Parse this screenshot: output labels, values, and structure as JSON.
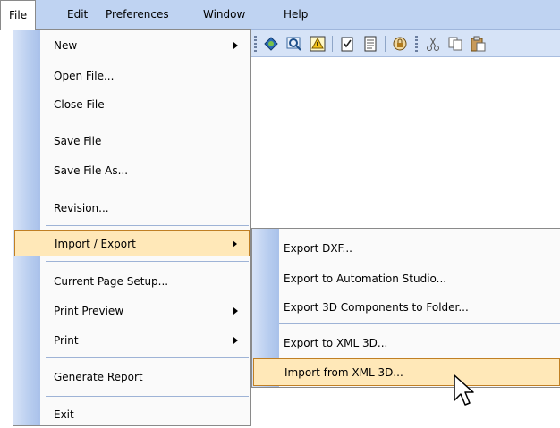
{
  "menubar": {
    "items": [
      {
        "label": "File"
      },
      {
        "label": "Edit"
      },
      {
        "label": "Preferences"
      },
      {
        "label": "Window"
      },
      {
        "label": "Help"
      }
    ]
  },
  "toolbar": {
    "icons": [
      "shape-tool-icon",
      "zoom-icon",
      "warning-icon",
      "checklist-icon",
      "document-icon",
      "lock-icon",
      "cut-icon",
      "copy-icon",
      "paste-icon"
    ]
  },
  "file_menu": {
    "items": [
      {
        "label": "New",
        "submenu": true
      },
      {
        "label": "Open File..."
      },
      {
        "label": "Close File"
      },
      {
        "label": "Save File"
      },
      {
        "label": "Save File As..."
      },
      {
        "label": "Revision..."
      },
      {
        "label": "Import / Export",
        "submenu": true,
        "highlighted": true
      },
      {
        "label": "Current Page Setup..."
      },
      {
        "label": "Print Preview",
        "submenu": true
      },
      {
        "label": "Print",
        "submenu": true
      },
      {
        "label": "Generate Report"
      },
      {
        "label": "Exit"
      }
    ]
  },
  "import_export_menu": {
    "items": [
      {
        "label": "Export DXF..."
      },
      {
        "label": "Export to Automation Studio..."
      },
      {
        "label": "Export 3D Components to Folder..."
      },
      {
        "label": "Export to XML 3D..."
      },
      {
        "label": "Import from XML 3D...",
        "highlighted": true
      }
    ]
  },
  "colors": {
    "menubar": "#bfd3f2",
    "highlight": "#ffe8b8",
    "highlight_border": "#c07f24",
    "gutter": "#b8cdef"
  }
}
